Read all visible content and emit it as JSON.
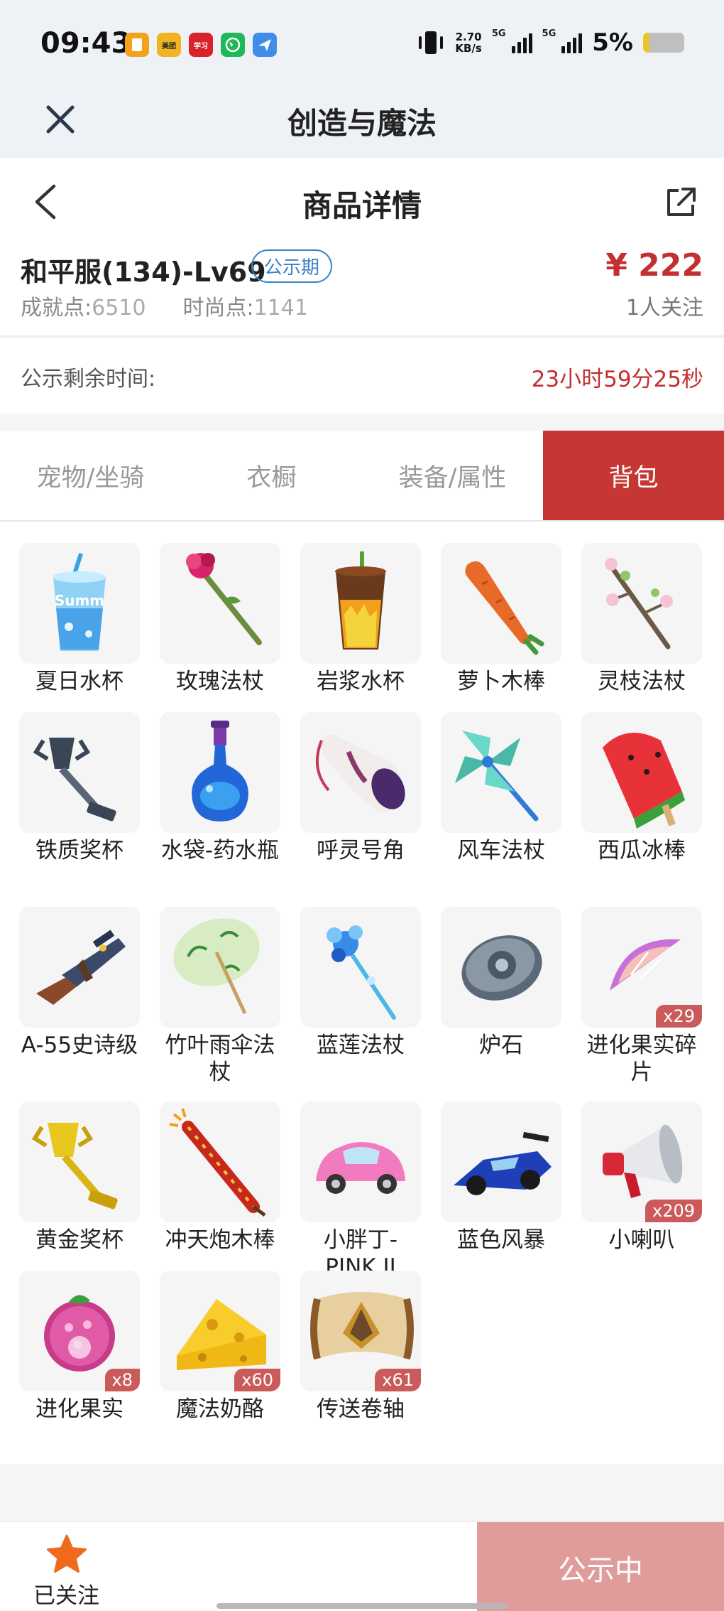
{
  "status_bar": {
    "time": "09:43",
    "net_speed": "2.70",
    "net_speed_unit": "KB/s",
    "signal1": "5G",
    "signal2": "5G",
    "battery": "5%",
    "battery_level": 0.05,
    "apps": [
      {
        "name": "notes-app",
        "color": "#f4a21b"
      },
      {
        "name": "meituan-app",
        "color": "#f2b321",
        "text": "美团"
      },
      {
        "name": "xuexi-app",
        "color": "#d8232a",
        "text": "学习"
      },
      {
        "name": "phone-app",
        "color": "#1fb95a"
      },
      {
        "name": "paper-plane-app",
        "color": "#3f8de8"
      }
    ]
  },
  "app_bar": {
    "title": "创造与魔法"
  },
  "nav": {
    "title": "商品详情"
  },
  "product": {
    "name": "和平服(134)-Lv69",
    "badge": "公示期",
    "achievement_label": "成就点:",
    "achievement_value": "6510",
    "fashion_label": "时尚点:",
    "fashion_value": "1141",
    "price": "¥ 222",
    "followers": "1人关注"
  },
  "remaining": {
    "label": "公示剩余时间:",
    "value": "23小时59分25秒"
  },
  "tabs": [
    {
      "label": "宠物/坐骑"
    },
    {
      "label": "衣橱"
    },
    {
      "label": "装备/属性"
    },
    {
      "label": "背包"
    }
  ],
  "active_tab": "背包",
  "items": [
    {
      "label": "夏日水杯",
      "icon": "summer-cup-icon"
    },
    {
      "label": "玫瑰法杖",
      "icon": "rose-staff-icon"
    },
    {
      "label": "岩浆水杯",
      "icon": "lava-cup-icon"
    },
    {
      "label": "萝卜木棒",
      "icon": "carrot-stick-icon"
    },
    {
      "label": "灵枝法杖",
      "icon": "spirit-branch-staff-icon"
    },
    {
      "label": "铁质奖杯",
      "icon": "iron-trophy-icon"
    },
    {
      "label": "水袋-药水瓶",
      "icon": "potion-bottle-icon"
    },
    {
      "label": "呼灵号角",
      "icon": "horn-icon"
    },
    {
      "label": "风车法杖",
      "icon": "pinwheel-staff-icon"
    },
    {
      "label": "西瓜冰棒",
      "icon": "watermelon-popsicle-icon"
    },
    {
      "label": "A-55史诗级",
      "icon": "rifle-icon"
    },
    {
      "label": "竹叶雨伞法杖",
      "icon": "bamboo-umbrella-icon"
    },
    {
      "label": "蓝莲法杖",
      "icon": "blue-lotus-staff-icon"
    },
    {
      "label": "炉石",
      "icon": "hearthstone-icon"
    },
    {
      "label": "进化果实碎片",
      "icon": "fruit-fragment-icon",
      "qty": "x29"
    },
    {
      "label": "黄金奖杯",
      "icon": "gold-trophy-icon"
    },
    {
      "label": "冲天炮木棒",
      "icon": "firework-rocket-icon"
    },
    {
      "label": "小胖丁-PINK II",
      "icon": "pink-car-icon"
    },
    {
      "label": "蓝色风暴",
      "icon": "blue-racecar-icon"
    },
    {
      "label": "小喇叭",
      "icon": "megaphone-icon",
      "qty": "x209"
    },
    {
      "label": "进化果实",
      "icon": "evolution-fruit-icon",
      "qty": "x8"
    },
    {
      "label": "魔法奶酪",
      "icon": "cheese-icon",
      "qty": "x60"
    },
    {
      "label": "传送卷轴",
      "icon": "teleport-scroll-icon",
      "qty": "x61"
    }
  ],
  "bottom": {
    "follow_label": "已关注",
    "status_label": "公示中"
  },
  "colors": {
    "accent": "#c63632",
    "price": "#c2302f",
    "badge": "#3b82c6",
    "status_button": "#e09c9a",
    "star": "#f06a1c"
  }
}
